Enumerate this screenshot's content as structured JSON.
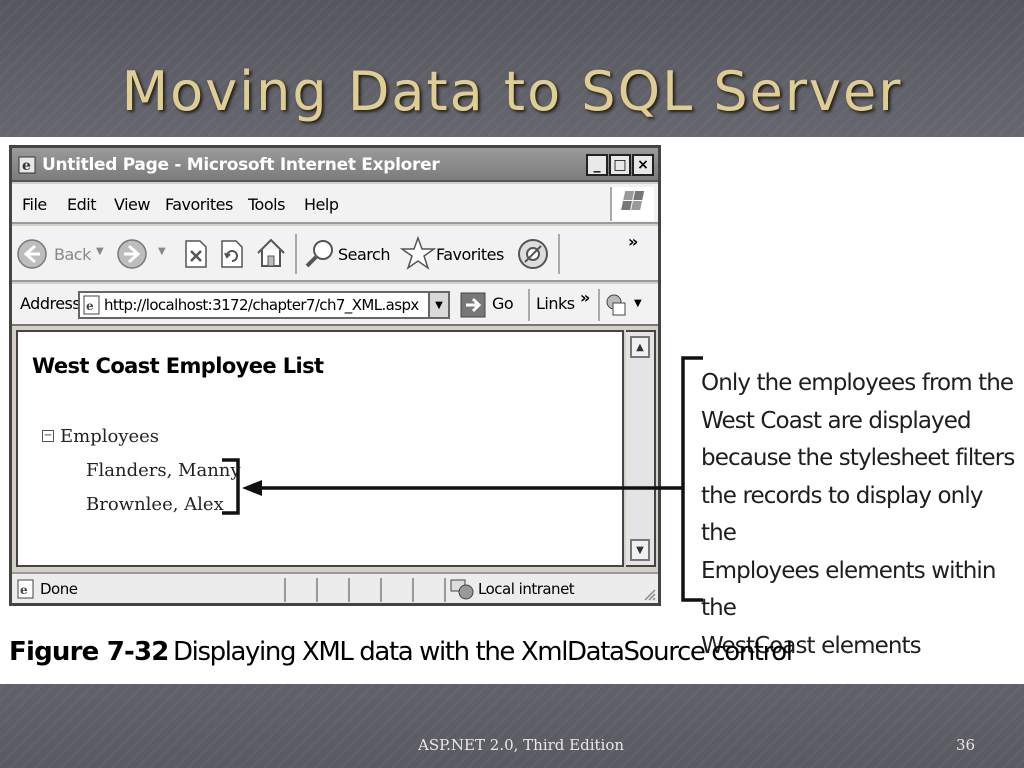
{
  "slide": {
    "title": "Moving Data to SQL Server",
    "footer_text": "ASP.NET 2.0, Third Edition",
    "page_number": "36"
  },
  "browser": {
    "window_title": "Untitled Page - Microsoft Internet Explorer",
    "window_buttons": [
      "_",
      "□",
      "×"
    ],
    "menu": [
      "File",
      "Edit",
      "View",
      "Favorites",
      "Tools",
      "Help"
    ],
    "toolbar": {
      "back_label": "Back",
      "search_label": "Search",
      "favorites_label": "Favorites",
      "overflow": "»"
    },
    "address": {
      "label": "Address",
      "url": "http://localhost:3172/chapter7/ch7_XML.aspx",
      "go_label": "Go",
      "links_label": "Links",
      "links_overflow": "»"
    },
    "page": {
      "heading": "West Coast Employee List",
      "tree_root": "Employees",
      "tree_items": [
        "Flanders, Manny",
        "Brownlee, Alex"
      ]
    },
    "status": {
      "text": "Done",
      "zone": "Local intranet"
    }
  },
  "callout": {
    "lines": [
      "Only the employees from the",
      "West Coast are displayed",
      "because the stylesheet filters",
      "the records to display only the",
      "Employees elements within the",
      "WestCoast elements"
    ]
  },
  "caption": {
    "number": "Figure 7-32",
    "text": "Displaying XML data with the XmlDataSource control"
  },
  "colors": {
    "title": "#e0cd92",
    "background": "#6c6c74",
    "figure_bg": "#ffffff"
  }
}
